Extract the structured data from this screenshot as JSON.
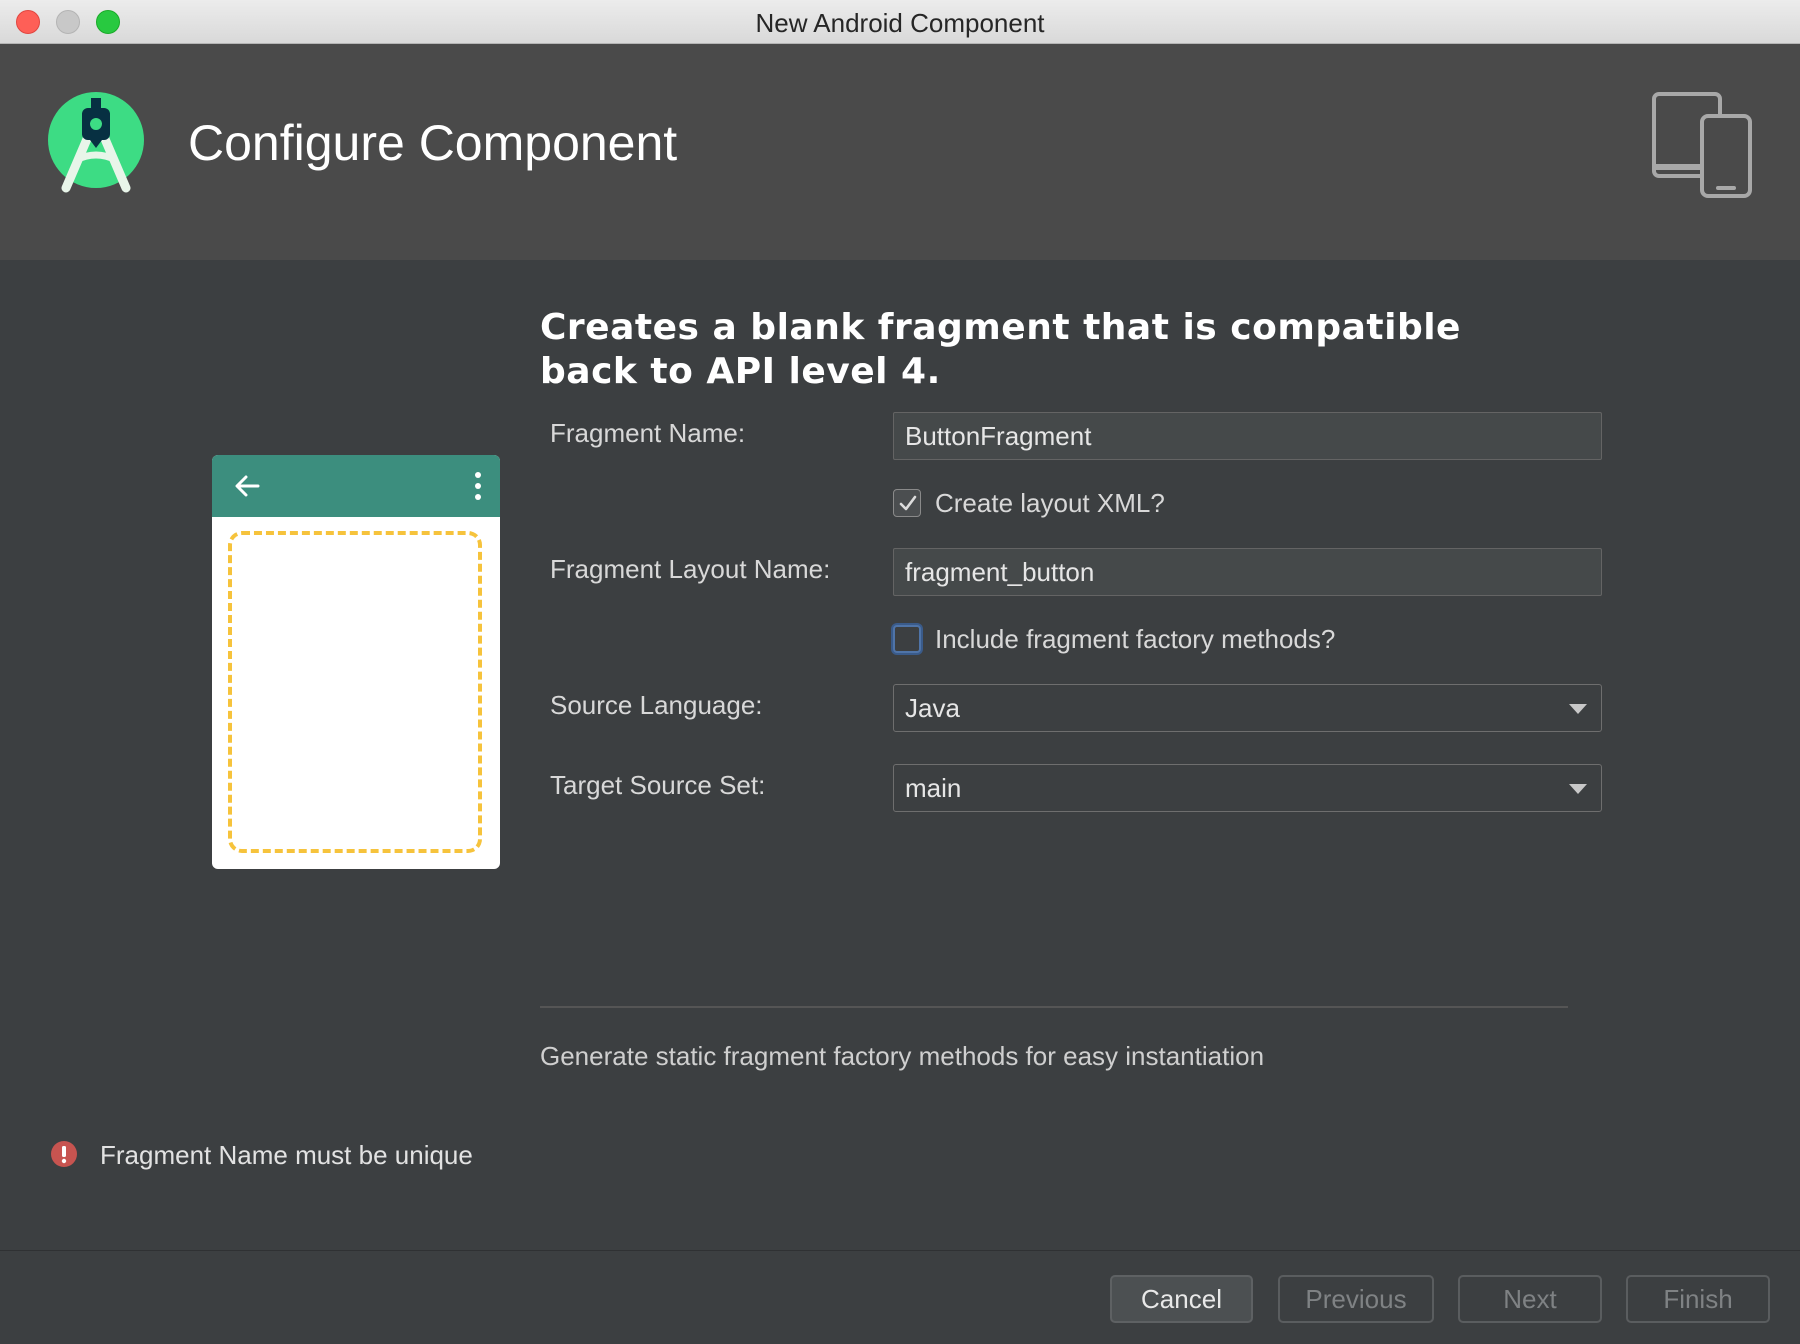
{
  "window": {
    "title": "New Android Component"
  },
  "header": {
    "title": "Configure Component",
    "logo_icon": "android-studio-logo-icon",
    "device_icon": "devices-icon"
  },
  "main": {
    "description": "Creates a blank fragment that is compatible back to API level 4.",
    "fragment_name": {
      "label": "Fragment Name:",
      "value": "ButtonFragment"
    },
    "create_layout_xml": {
      "label": "Create layout XML?",
      "checked": true
    },
    "fragment_layout_name": {
      "label": "Fragment Layout Name:",
      "value": "fragment_button"
    },
    "include_factory_methods": {
      "label": "Include fragment factory methods?",
      "checked": false
    },
    "source_language": {
      "label": "Source Language:",
      "value": "Java"
    },
    "target_source_set": {
      "label": "Target Source Set:",
      "value": "main"
    },
    "help_text": "Generate static fragment factory methods for easy instantiation"
  },
  "validation": {
    "error_message": "Fragment Name must be unique",
    "error_color": "#c75450"
  },
  "footer": {
    "cancel": "Cancel",
    "previous": "Previous",
    "next": "Next",
    "finish": "Finish"
  },
  "colors": {
    "accent_green": "#3ddc84",
    "appbar_teal": "#3c8e7e",
    "dashed_yellow": "#f6c33c",
    "focus_blue": "#4f74a8"
  }
}
